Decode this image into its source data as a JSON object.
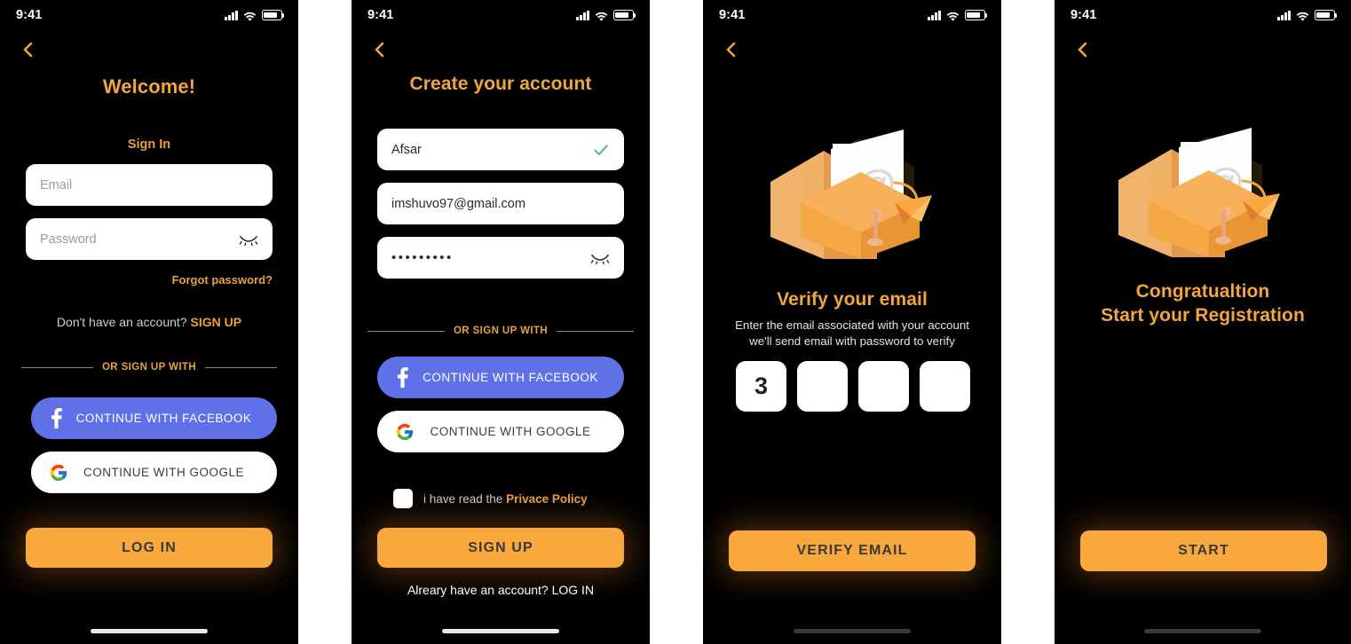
{
  "statusbar": {
    "time": "9:41",
    "signal_icon": "signal-bars-icon",
    "wifi_icon": "wifi-icon",
    "battery_icon": "battery-icon"
  },
  "screens": [
    {
      "id": "sign-in",
      "title": "Welcome!",
      "section_label": "Sign In",
      "email_placeholder": "Email",
      "password_placeholder": "Password",
      "forgot_link": "Forgot password?",
      "signup_prompt": "Don't have an account? ",
      "signup_link": "SIGN UP",
      "divider_label": "OR SIGN UP WITH",
      "facebook_label": "CONTINUE WITH FACEBOOK",
      "google_label": "CONTINUE WITH GOOGLE",
      "cta_label": "LOG IN"
    },
    {
      "id": "create-account",
      "title": "Create your account",
      "name_value": "Afsar",
      "email_value": "imshuvo97@gmail.com",
      "password_value": "•••••••••",
      "divider_label": "OR SIGN UP WITH",
      "facebook_label": "CONTINUE WITH FACEBOOK",
      "google_label": "CONTINUE WITH GOOGLE",
      "policy_prefix": "i have read the ",
      "policy_link": "Privace Policy",
      "cta_label": "SIGN UP",
      "login_prompt": "Alreary have an account? ",
      "login_link": "LOG IN"
    },
    {
      "id": "verify-email",
      "title": "Verify your email",
      "subcopy_line1": "Enter the email associated with your account",
      "subcopy_line2": "we'll send email with password to verify",
      "otp_values": [
        "3",
        "",
        "",
        ""
      ],
      "cta_label": "VERIFY EMAIL"
    },
    {
      "id": "congratulation",
      "title_line1": "Congratualtion",
      "title_line2": "Start your Registration",
      "cta_label": "START"
    }
  ],
  "colors": {
    "background": "#000000",
    "accent_orange": "#F2A63B",
    "cta_orange": "#F9A83E",
    "facebook_blue": "#6071E8",
    "white": "#FFFFFF",
    "check_green": "#5CB98B"
  },
  "icons": {
    "back": "chevron-left-icon",
    "eye_off": "eye-off-icon",
    "check": "check-icon",
    "facebook": "facebook-icon",
    "google": "google-icon",
    "envelope": "envelope-mail-illustration"
  }
}
